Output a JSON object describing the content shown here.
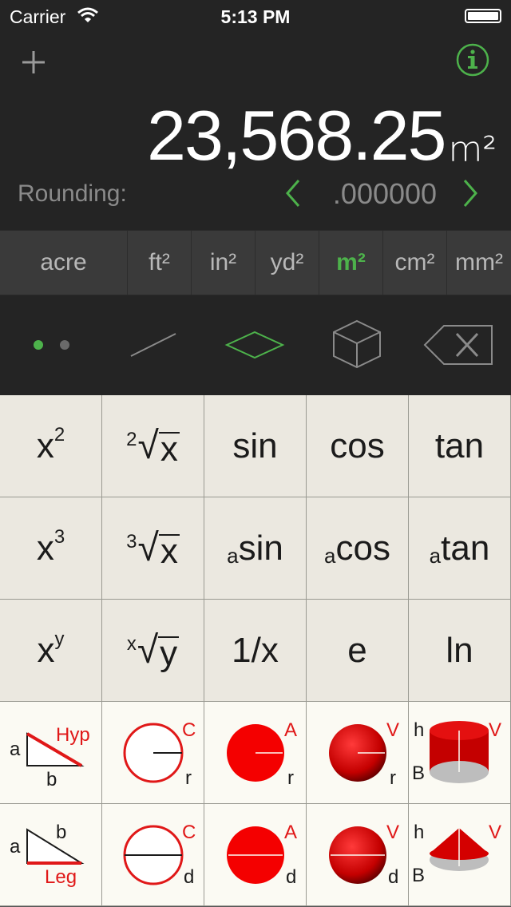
{
  "status_bar": {
    "carrier": "Carrier",
    "time": "5:13 PM"
  },
  "display": {
    "value": "23,568.25",
    "unit": "m²"
  },
  "rounding": {
    "label": "Rounding:",
    "value": ".000000"
  },
  "units": [
    "acre",
    "ft²",
    "in²",
    "yd²",
    "m²",
    "cm²",
    "mm²"
  ],
  "selected_unit": "m²",
  "colors": {
    "accent": "#4db24b",
    "background": "#242424",
    "key_scientific": "#ebe8e0",
    "key_geometry": "#fbfaf3",
    "red": "#e01818"
  },
  "keys_scientific": {
    "x2": {
      "base": "x",
      "sup": "2"
    },
    "sqrt2": {
      "index": "2",
      "radical": "√",
      "arg": "x"
    },
    "sin": "sin",
    "cos": "cos",
    "tan": "tan",
    "x3": {
      "base": "x",
      "sup": "3"
    },
    "sqrt3": {
      "index": "3",
      "radical": "√",
      "arg": "x"
    },
    "asin": {
      "prefix": "a",
      "main": "sin"
    },
    "acos": {
      "prefix": "a",
      "main": "cos"
    },
    "atan": {
      "prefix": "a",
      "main": "tan"
    },
    "xy": {
      "base": "x",
      "sup": "y"
    },
    "rootx": {
      "index": "x",
      "radical": "√",
      "arg": "y"
    },
    "recip": "1/x",
    "e": "e",
    "ln": "ln"
  },
  "keys_geometry": {
    "hyp": {
      "a": "a",
      "b": "b",
      "result": "Hyp"
    },
    "circumference_r": {
      "result": "C",
      "input": "r"
    },
    "area_r": {
      "result": "A",
      "input": "r"
    },
    "volume_sphere_r": {
      "result": "V",
      "input": "r"
    },
    "volume_cylinder": {
      "h": "h",
      "b": "B",
      "result": "V"
    },
    "leg": {
      "a": "a",
      "b": "b",
      "result": "Leg"
    },
    "circumference_d": {
      "result": "C",
      "input": "d"
    },
    "area_d": {
      "result": "A",
      "input": "d"
    },
    "volume_sphere_d": {
      "result": "V",
      "input": "d"
    },
    "volume_cone": {
      "h": "h",
      "b": "B",
      "result": "V"
    }
  },
  "icons": [
    "wifi-icon",
    "battery-icon",
    "plus-icon",
    "info-icon",
    "chevron-left-icon",
    "chevron-right-icon",
    "line-icon",
    "rhombus-icon",
    "cube-icon",
    "backspace-icon"
  ]
}
